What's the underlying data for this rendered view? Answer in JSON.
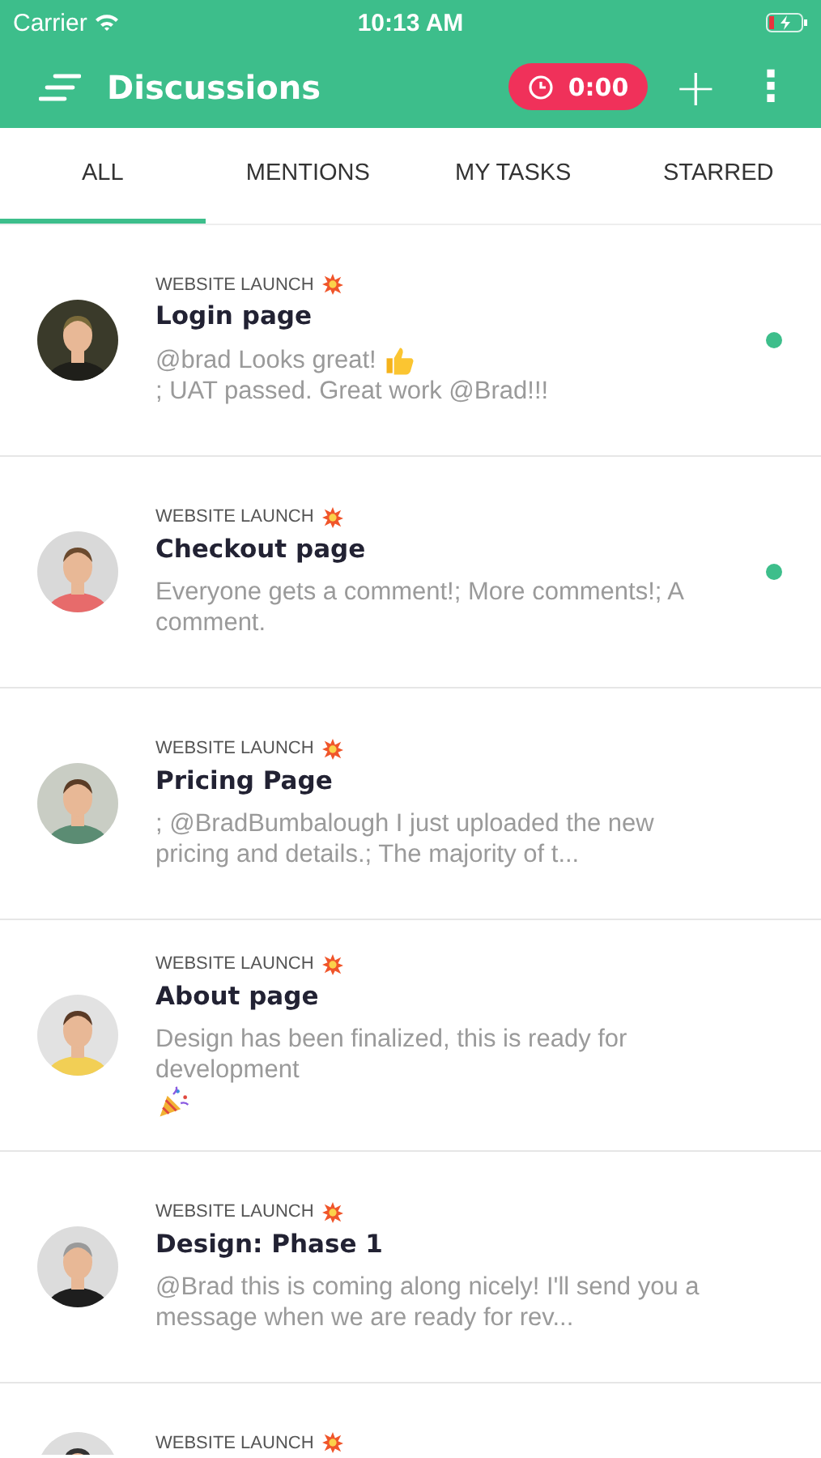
{
  "status_bar": {
    "carrier": "Carrier",
    "time": "10:13 AM"
  },
  "header": {
    "title": "Discussions",
    "timer": "0:00",
    "add": "+",
    "more": "⋮"
  },
  "tabs": [
    {
      "label": "ALL",
      "selected": true
    },
    {
      "label": "MENTIONS",
      "selected": false
    },
    {
      "label": "MY TASKS",
      "selected": false
    },
    {
      "label": "STARRED",
      "selected": false
    }
  ],
  "discussions": [
    {
      "project": "WEBSITE LAUNCH",
      "title": "Login page",
      "preview": [
        "@brad Looks great!",
        "; UAT passed. Great work @Brad!!!"
      ],
      "kind": "thumbsup",
      "unread": true
    },
    {
      "project": "WEBSITE LAUNCH",
      "title": "Checkout page",
      "preview": [
        "Everyone gets a comment!; More comments!; A comment."
      ],
      "unread": true
    },
    {
      "project": "WEBSITE LAUNCH",
      "title": "Pricing Page",
      "preview": [
        "; @BradBumbalough I just uploaded the new pricing and details.; The majority of t..."
      ],
      "unread": false
    },
    {
      "project": "WEBSITE LAUNCH",
      "title": "About page",
      "preview": [
        "Design has been finalized, this is ready for development"
      ],
      "kind": "celebration",
      "unread": false
    },
    {
      "project": "WEBSITE LAUNCH",
      "title": "Design: Phase 1",
      "preview": [
        "@Brad this is coming along nicely! I'll send you a message when we are ready for rev..."
      ],
      "unread": false
    },
    {
      "project": "WEBSITE LAUNCH"
    }
  ]
}
